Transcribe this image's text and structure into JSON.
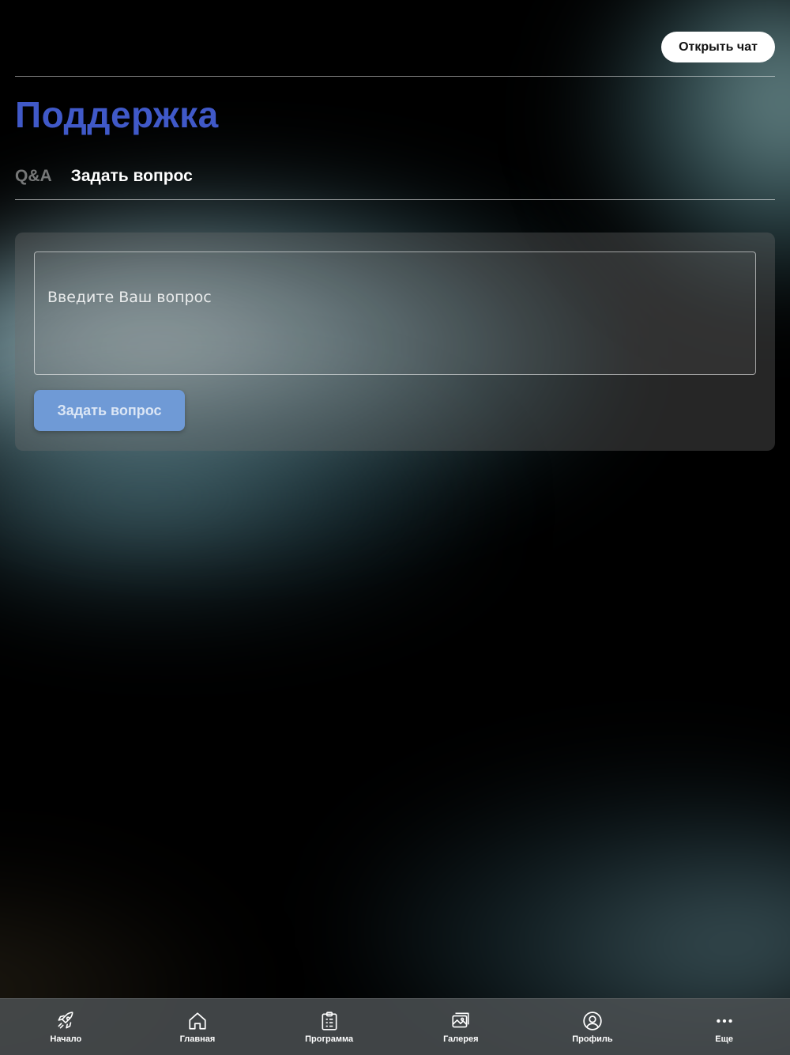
{
  "header": {
    "open_chat_label": "Открыть чат"
  },
  "page": {
    "title": "Поддержка"
  },
  "tabs": [
    {
      "label": "Q&A",
      "active": false
    },
    {
      "label": "Задать вопрос",
      "active": true
    }
  ],
  "form": {
    "question_placeholder": "Введите Ваш вопрос",
    "question_value": "",
    "submit_label": "Задать вопрос"
  },
  "bottom_nav": {
    "items": [
      {
        "label": "Начало",
        "icon": "rocket-icon"
      },
      {
        "label": "Главная",
        "icon": "home-icon"
      },
      {
        "label": "Программа",
        "icon": "clipboard-icon"
      },
      {
        "label": "Галерея",
        "icon": "gallery-icon"
      },
      {
        "label": "Профиль",
        "icon": "profile-icon"
      },
      {
        "label": "Еще",
        "icon": "more-icon"
      }
    ]
  },
  "colors": {
    "title": "#4059c8",
    "button": "#6f9ad6",
    "background": "#000000"
  }
}
